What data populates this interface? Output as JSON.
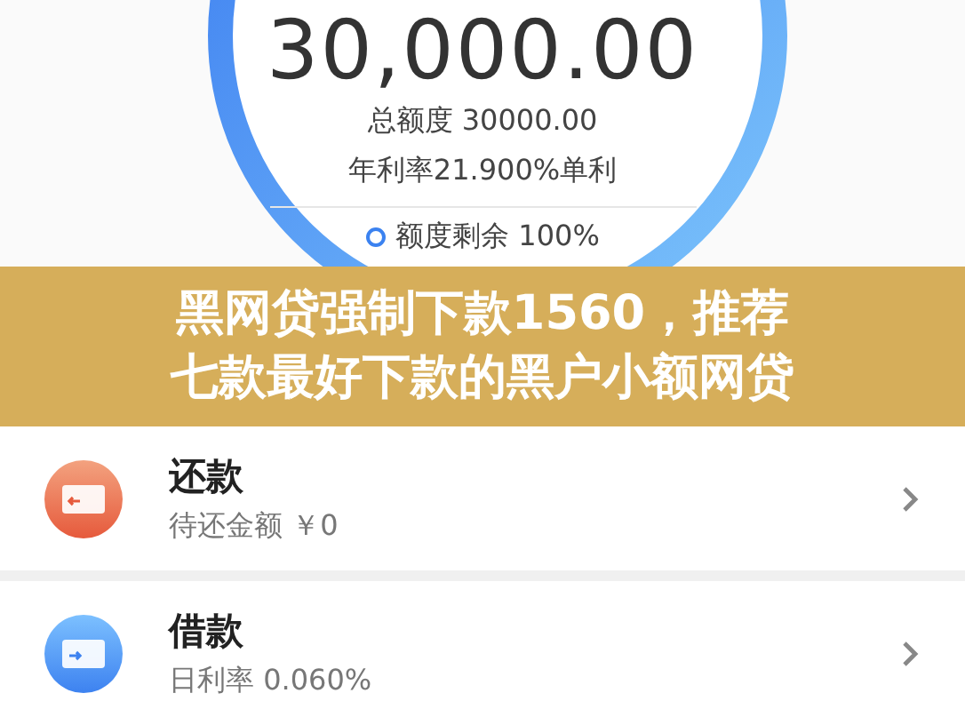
{
  "credit": {
    "amount": "30,000.00",
    "total": "总额度 30000.00",
    "rate": "年利率21.900%单利",
    "remaining": "额度剩余 100%"
  },
  "banner": {
    "lines": [
      "黑网贷强制下款1560，推荐",
      "七款最好下款的黑户小额网贷"
    ]
  },
  "cards": [
    {
      "kind": "repay",
      "title": "还款",
      "subtitle": "待还金额 ￥0"
    },
    {
      "kind": "borrow",
      "title": "借款",
      "subtitle": "日利率 0.060%"
    }
  ]
}
